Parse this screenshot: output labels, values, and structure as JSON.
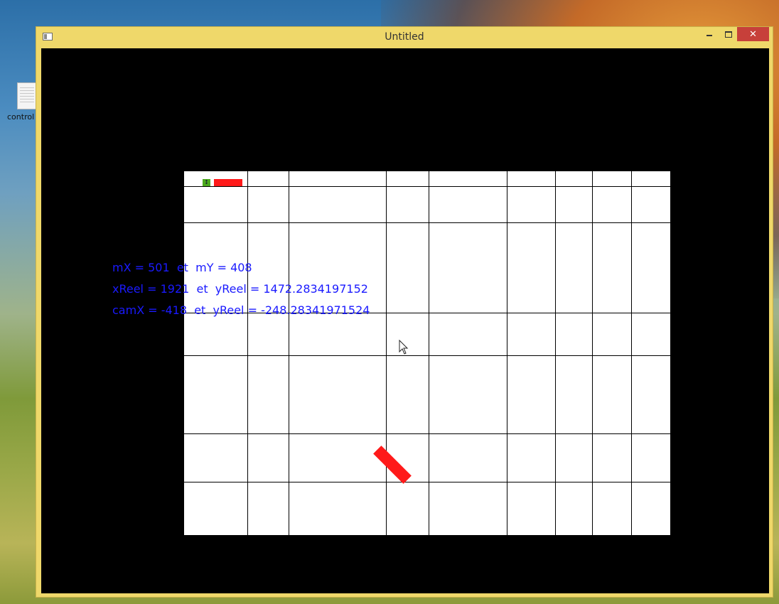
{
  "desktop": {
    "icon_label": "control"
  },
  "window": {
    "title": "Untitled",
    "controls": {
      "minimize": "minimize-icon",
      "maximize": "maximize-icon",
      "close": "✕"
    }
  },
  "game": {
    "green_item_glyph": "↕",
    "debug_lines": [
      "mX = 501  et  mY = 408",
      "xReel = 1921  et  yReel = 1472.2834197152",
      "camX = -418  et  yReel = -248.28341971524"
    ]
  },
  "colors": {
    "frame": "#efd86a",
    "close_button": "#c7403a",
    "client_background": "#000000",
    "board": "#ffffff",
    "grid_lines": "#000000",
    "debug_text": "#1a1aff",
    "red_objects": "#ff1a1a",
    "green_item": "#4caa1e"
  }
}
